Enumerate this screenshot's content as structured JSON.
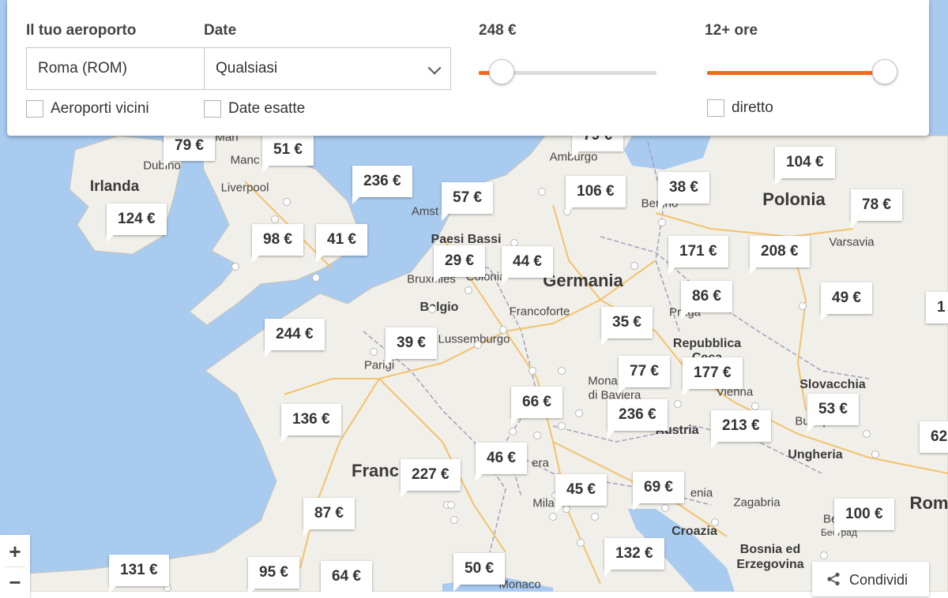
{
  "search": {
    "airport_label": "Il tuo aeroporto",
    "airport_value": "Roma (ROM)",
    "nearby_label": "Aeroporti vicini",
    "date_label": "Date",
    "date_value": "Qualsiasi",
    "exact_label": "Date esatte",
    "price_label": "248 €",
    "price_slider_fraction": 0.13,
    "duration_label": "12+ ore",
    "duration_slider_fraction": 1.0,
    "direct_label": "diretto"
  },
  "colors": {
    "accent": "#f26b1d",
    "water": "#a9cbf0",
    "land": "#f1efe9"
  },
  "map_labels": {
    "countries": {
      "ireland": "Irlanda",
      "poland": "Polonia",
      "germany": "Germania",
      "netherlands": "Paesi Bassi",
      "belgium": "Belgio",
      "czech_1": "Repubblica",
      "czech_2": "Ceca",
      "slovakia": "Slovacchia",
      "austria": "Austria",
      "hungary": "Ungheria",
      "france": "Franc",
      "croatia": "Croazia",
      "bosnia_1": "Bosnia ed",
      "bosnia_2": "Erzegovina",
      "rome_partial": "Rom"
    },
    "cities": {
      "dublin": "Dubino",
      "manchester": "Manc",
      "liverpool": "Liverpool",
      "hamburg": "Amburgo",
      "berlin": "Berlino",
      "warsaw": "Varsavia",
      "amsterdam": "Amst",
      "brussels": "Bruxelles",
      "cologne": "Colonia",
      "frankfurt": "Francoforte",
      "luxembourg": "Lussemburgo",
      "prague": "Praga",
      "paris": "Parigi",
      "munich_1": "Mona",
      "munich_2": "di Baviera",
      "vienna": "Vienna",
      "budapest": "Budap",
      "zagreb": "Zagabria",
      "belgrade_1": "Belg",
      "belgrade_2": "Београд",
      "milan": "Mila",
      "monaco": "Monaco",
      "swiss_partial": "era",
      "slovenia_partial": "enia",
      "man_partial": "Man"
    }
  },
  "destinations": [
    {
      "id": "dublin",
      "price": "79 €"
    },
    {
      "id": "manchester",
      "price": "51 €"
    },
    {
      "id": "hamburg",
      "price": "79 €"
    },
    {
      "id": "copenhagen",
      "price": "104 €"
    },
    {
      "id": "leeds",
      "price": "236 €"
    },
    {
      "id": "amsterdam",
      "price": "57 €"
    },
    {
      "id": "hanover",
      "price": "106 €"
    },
    {
      "id": "berlin",
      "price": "38 €"
    },
    {
      "id": "warsaw",
      "price": "78 €"
    },
    {
      "id": "cork",
      "price": "124 €"
    },
    {
      "id": "bristol",
      "price": "98 €"
    },
    {
      "id": "london",
      "price": "41 €"
    },
    {
      "id": "eindhoven",
      "price": "29 €"
    },
    {
      "id": "cologne",
      "price": "44 €"
    },
    {
      "id": "dresden",
      "price": "171 €"
    },
    {
      "id": "wroclaw",
      "price": "208 €"
    },
    {
      "id": "prague",
      "price": "86 €"
    },
    {
      "id": "krakow",
      "price": "49 €"
    },
    {
      "id": "nantes",
      "price": "244 €"
    },
    {
      "id": "paris",
      "price": "39 €"
    },
    {
      "id": "nuremberg",
      "price": "35 €"
    },
    {
      "id": "munich",
      "price": "77 €"
    },
    {
      "id": "vienna",
      "price": "177 €"
    },
    {
      "id": "basel",
      "price": "66 €"
    },
    {
      "id": "salzburg",
      "price": "236 €"
    },
    {
      "id": "bratislava",
      "price": "213 €"
    },
    {
      "id": "budapest",
      "price": "53 €"
    },
    {
      "id": "bordeaux",
      "price": "136 €"
    },
    {
      "id": "geneva",
      "price": "46 €"
    },
    {
      "id": "lyon",
      "price": "227 €"
    },
    {
      "id": "milan",
      "price": "45 €"
    },
    {
      "id": "venice",
      "price": "69 €"
    },
    {
      "id": "belgrade",
      "price": "100 €"
    },
    {
      "id": "toulouse",
      "price": "87 €"
    },
    {
      "id": "bologna",
      "price": "132 €"
    },
    {
      "id": "bilbao",
      "price": "131 €"
    },
    {
      "id": "pamplona",
      "price": "95 €"
    },
    {
      "id": "montpellier",
      "price": "64 €"
    },
    {
      "id": "nice",
      "price": "50 €"
    },
    {
      "id": "edge_east",
      "price": "62"
    },
    {
      "id": "edge_east_top",
      "price": "1"
    }
  ],
  "controls": {
    "zoom_in": "+",
    "zoom_out": "−",
    "share_label": "Condividi"
  }
}
